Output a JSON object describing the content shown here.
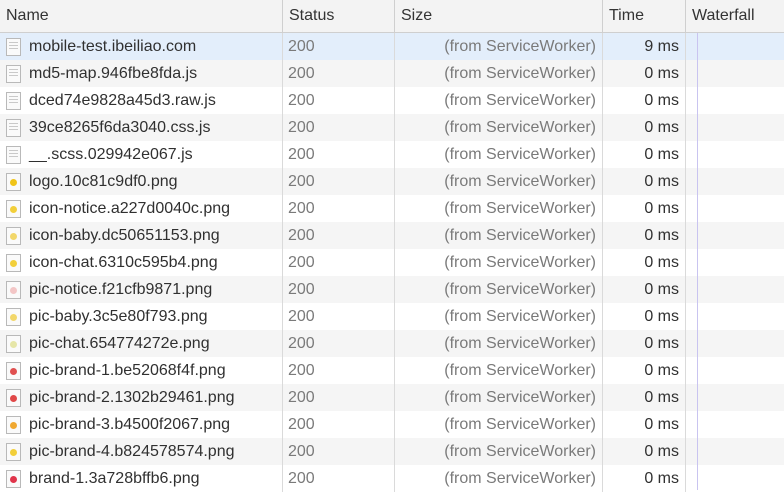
{
  "columns": [
    "Name",
    "Status",
    "Size",
    "Time",
    "Waterfall"
  ],
  "rows": [
    {
      "name": "mobile-test.ibeiliao.com",
      "status": "200",
      "size": "(from ServiceWorker)",
      "time": "9 ms",
      "icon": "document-icon",
      "selected": true
    },
    {
      "name": "md5-map.946fbe8fda.js",
      "status": "200",
      "size": "(from ServiceWorker)",
      "time": "0 ms",
      "icon": "document-icon"
    },
    {
      "name": "dced74e9828a45d3.raw.js",
      "status": "200",
      "size": "(from ServiceWorker)",
      "time": "0 ms",
      "icon": "document-icon"
    },
    {
      "name": "39ce8265f6da3040.css.js",
      "status": "200",
      "size": "(from ServiceWorker)",
      "time": "0 ms",
      "icon": "document-icon"
    },
    {
      "name": "__.scss.029942e067.js",
      "status": "200",
      "size": "(from ServiceWorker)",
      "time": "0 ms",
      "icon": "document-icon"
    },
    {
      "name": "logo.10c81c9df0.png",
      "status": "200",
      "size": "(from ServiceWorker)",
      "time": "0 ms",
      "icon": "image-icon",
      "color": "#f0c419"
    },
    {
      "name": "icon-notice.a227d0040c.png",
      "status": "200",
      "size": "(from ServiceWorker)",
      "time": "0 ms",
      "icon": "image-icon",
      "color": "#f2cf3a"
    },
    {
      "name": "icon-baby.dc50651153.png",
      "status": "200",
      "size": "(from ServiceWorker)",
      "time": "0 ms",
      "icon": "image-icon",
      "color": "#f2d76a"
    },
    {
      "name": "icon-chat.6310c595b4.png",
      "status": "200",
      "size": "(from ServiceWorker)",
      "time": "0 ms",
      "icon": "image-icon",
      "color": "#f2cf3a"
    },
    {
      "name": "pic-notice.f21cfb9871.png",
      "status": "200",
      "size": "(from ServiceWorker)",
      "time": "0 ms",
      "icon": "image-icon",
      "color": "#f3c6c6"
    },
    {
      "name": "pic-baby.3c5e80f793.png",
      "status": "200",
      "size": "(from ServiceWorker)",
      "time": "0 ms",
      "icon": "image-icon",
      "color": "#f2d76a"
    },
    {
      "name": "pic-chat.654774272e.png",
      "status": "200",
      "size": "(from ServiceWorker)",
      "time": "0 ms",
      "icon": "image-icon",
      "color": "#e6e6a8"
    },
    {
      "name": "pic-brand-1.be52068f4f.png",
      "status": "200",
      "size": "(from ServiceWorker)",
      "time": "0 ms",
      "icon": "image-icon",
      "color": "#e05050"
    },
    {
      "name": "pic-brand-2.1302b29461.png",
      "status": "200",
      "size": "(from ServiceWorker)",
      "time": "0 ms",
      "icon": "image-icon",
      "color": "#e04848"
    },
    {
      "name": "pic-brand-3.b4500f2067.png",
      "status": "200",
      "size": "(from ServiceWorker)",
      "time": "0 ms",
      "icon": "image-icon",
      "color": "#f0a830"
    },
    {
      "name": "pic-brand-4.b824578574.png",
      "status": "200",
      "size": "(from ServiceWorker)",
      "time": "0 ms",
      "icon": "image-icon",
      "color": "#f2cf3a"
    },
    {
      "name": "brand-1.3a728bffb6.png",
      "status": "200",
      "size": "(from ServiceWorker)",
      "time": "0 ms",
      "icon": "image-icon",
      "color": "#e0344a"
    }
  ],
  "colors": {
    "waterfall_bar": "#1aa0e8",
    "selected_row": "#e3eefb"
  }
}
